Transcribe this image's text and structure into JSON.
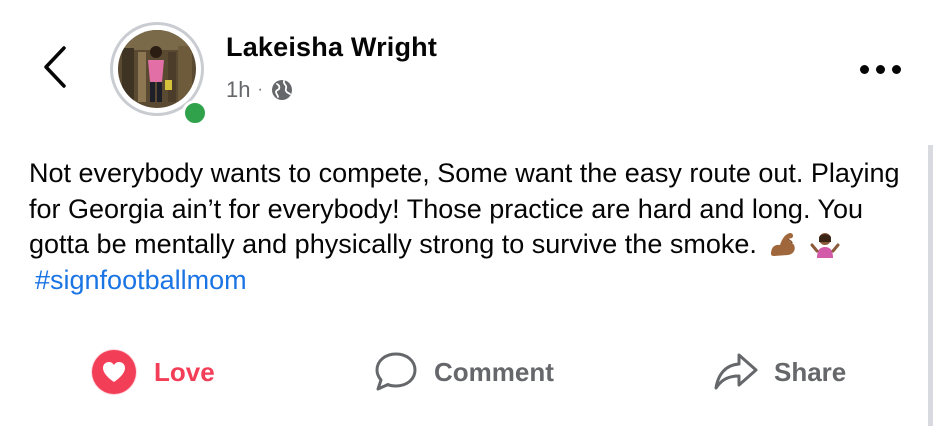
{
  "post": {
    "author": "Lakeisha Wright",
    "time": "1h",
    "separator": "·",
    "audience_icon": "globe-icon",
    "text_main": "Not everybody wants to compete, Some want the easy route out. Playing for Georgia ain’t for everybody! Those practice are hard and long. You gotta be mentally and physically strong to survive the smoke.",
    "emojis": [
      "flexed-biceps-emoji",
      "person-shrugging-emoji"
    ],
    "hashtag": "#signfootballmom",
    "online": true
  },
  "actions": {
    "love": "Love",
    "comment": "Comment",
    "share": "Share"
  },
  "colors": {
    "love": "#f33e58",
    "hashtag": "#1b74e4",
    "secondary_text": "#65676b",
    "online": "#31a24c"
  }
}
